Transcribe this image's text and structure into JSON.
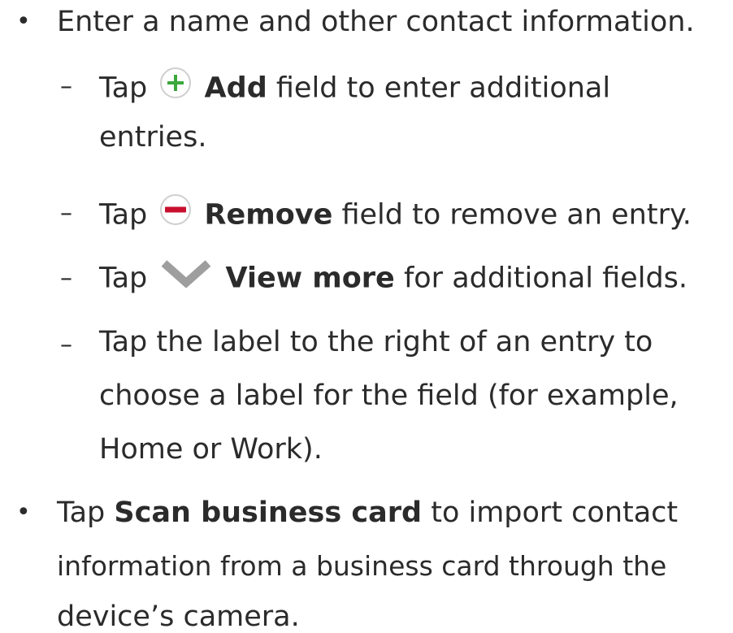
{
  "items": [
    {
      "bullet": "•",
      "text": "Enter a name and other contact information."
    },
    {
      "dash": "–",
      "prefix": "Tap",
      "bold": "Add",
      "suffix": "field to enter additional",
      "line2": "entries.",
      "icon": "add-circle-icon",
      "icon_color": "#3aa83a"
    },
    {
      "dash": "–",
      "prefix": "Tap",
      "bold": "Remove",
      "suffix": "field to remove an entry.",
      "icon": "remove-circle-icon",
      "icon_color": "#c8102e"
    },
    {
      "dash": "–",
      "prefix": "Tap",
      "bold": "View more",
      "suffix": "for additional fields.",
      "icon": "chevron-down-icon",
      "icon_color": "#9e9e9e"
    },
    {
      "dash": "–",
      "line1": "Tap the label to the right of an entry to",
      "line2": "choose a label for the field (for example,",
      "line3": "Home or Work)."
    },
    {
      "bullet": "•",
      "prefix": "Tap",
      "bold": "Scan business card",
      "suffix": "to import contact",
      "line2": "information from a business card through the",
      "line3": "device’s camera."
    }
  ]
}
